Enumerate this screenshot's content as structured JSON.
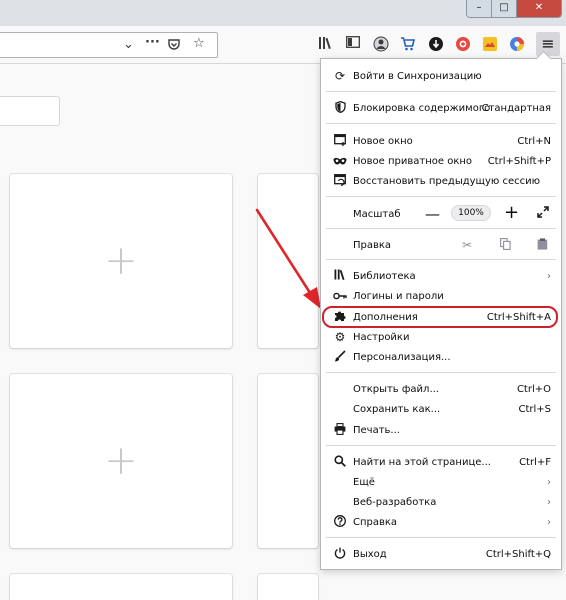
{
  "window": {
    "minimize": "–",
    "maximize": "□",
    "close": "✕"
  },
  "toolbar": {
    "url_icons": [
      "chevron-down-icon",
      "more-icon",
      "pocket-icon",
      "star-icon"
    ],
    "icons": [
      "library-icon",
      "sidebar-icon",
      "extension-icon",
      "cart-icon",
      "extension-icon",
      "extension-icon",
      "extension-icon",
      "extension-icon",
      "menu-icon"
    ]
  },
  "menu": {
    "sync": "Войти в Синхронизацию",
    "content_blocking": {
      "label": "Блокировка содержимого",
      "value": "Стандартная"
    },
    "new_window": {
      "label": "Новое окно",
      "shortcut": "Ctrl+N"
    },
    "new_private": {
      "label": "Новое приватное окно",
      "shortcut": "Ctrl+Shift+P"
    },
    "restore": {
      "label": "Восстановить предыдущую сессию"
    },
    "zoom": {
      "label": "Масштаб",
      "minus": "—",
      "value": "100%",
      "plus": "+"
    },
    "edit": {
      "label": "Правка"
    },
    "library": {
      "label": "Библиотека"
    },
    "logins": {
      "label": "Логины и пароли"
    },
    "addons": {
      "label": "Дополнения",
      "shortcut": "Ctrl+Shift+A"
    },
    "settings": {
      "label": "Настройки"
    },
    "customize": {
      "label": "Персонализация..."
    },
    "open_file": {
      "label": "Открыть файл...",
      "shortcut": "Ctrl+O"
    },
    "save_as": {
      "label": "Сохранить как...",
      "shortcut": "Ctrl+S"
    },
    "print": {
      "label": "Печать..."
    },
    "find": {
      "label": "Найти на этой странице...",
      "shortcut": "Ctrl+F"
    },
    "more": {
      "label": "Ещё"
    },
    "web_dev": {
      "label": "Веб-разработка"
    },
    "help": {
      "label": "Справка"
    },
    "exit": {
      "label": "Выход",
      "shortcut": "Ctrl+Shift+Q"
    }
  },
  "tiles": {
    "plus": "+"
  },
  "colors": {
    "highlight": "#d0202a",
    "arrow": "#e0262b"
  }
}
